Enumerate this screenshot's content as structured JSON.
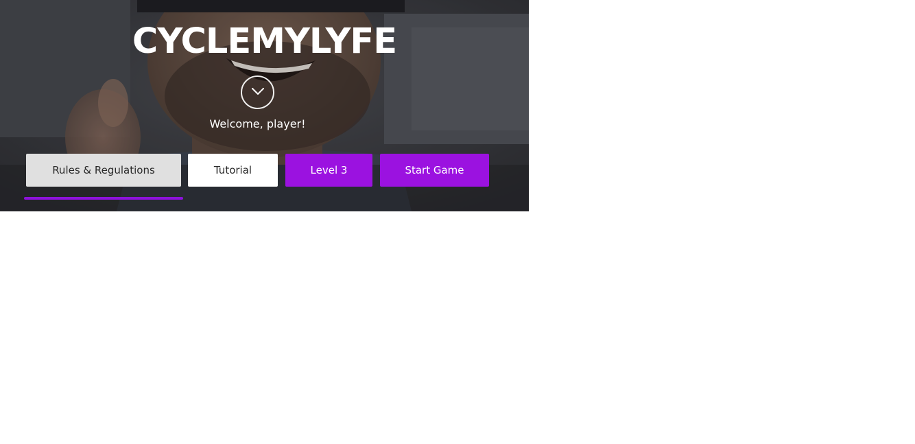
{
  "app": {
    "title": "CYCLEMYLYFE",
    "welcome": "Welcome, player!"
  },
  "hero": {
    "background_image": "smiling-man-photo",
    "scroll_icon": "chevron-down-icon"
  },
  "buttons": {
    "rules": "Rules & Regulations",
    "tutorial": "Tutorial",
    "level": "Level 3",
    "start": "Start Game",
    "active": "rules"
  },
  "colors": {
    "accent": "#9b12e0",
    "underline": "#8d12db",
    "rules_bg": "#e0e0e0",
    "tutorial_bg": "#ffffff"
  }
}
